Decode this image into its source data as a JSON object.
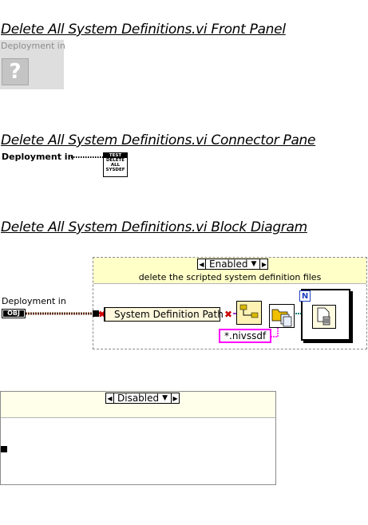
{
  "headings": {
    "front_panel": "Delete All System Definitions.vi Front Panel",
    "connector_pane": "Delete All System Definitions.vi Connector Pane",
    "block_diagram": "Delete All System Definitions.vi Block Diagram"
  },
  "front_panel": {
    "control_label": "Deployment in",
    "control_glyph": "?"
  },
  "connector_pane": {
    "terminal_label": "Deployment in",
    "icon_lines": [
      "TEST",
      "DELETE",
      "ALL",
      "SYSDEF"
    ]
  },
  "block_diagram": {
    "terminal_label": "Deployment in",
    "terminal_tag": "OBJ",
    "case_enabled": {
      "selector_value": "Enabled",
      "comment": "delete the scripted system definition files",
      "property_label": "System Definition Path",
      "pattern_constant": "*.nivssdf",
      "loop_label": "N"
    },
    "case_disabled": {
      "selector_value": "Disabled"
    }
  },
  "colors": {
    "wire_class": "#5b2b12",
    "wire_path": "#9b3bc7",
    "wire_string": "#ff00ff",
    "error_red": "#cc0000",
    "structure_fill": "#ffffc8"
  }
}
